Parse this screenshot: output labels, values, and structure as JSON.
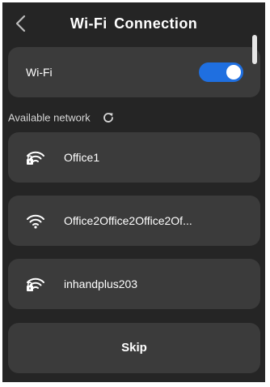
{
  "header": {
    "back_icon": "chevron-left-icon",
    "title": "Wi-Fi Connection"
  },
  "wifi": {
    "label": "Wi-Fi",
    "enabled": true,
    "toggle_color": "#1f6fe0"
  },
  "available": {
    "label": "Available network",
    "refresh_icon": "refresh-icon"
  },
  "networks": [
    {
      "name": "Office1",
      "secured": true,
      "icon": "wifi-lock-icon"
    },
    {
      "name": "Office2Office2Office2Of...",
      "secured": false,
      "icon": "wifi-icon"
    },
    {
      "name": "inhandplus203",
      "secured": true,
      "icon": "wifi-lock-icon"
    }
  ],
  "skip": {
    "label": "Skip"
  },
  "colors": {
    "background": "#252525",
    "card": "#3b3b3b",
    "text": "#ffffff",
    "accent": "#1f6fe0"
  }
}
